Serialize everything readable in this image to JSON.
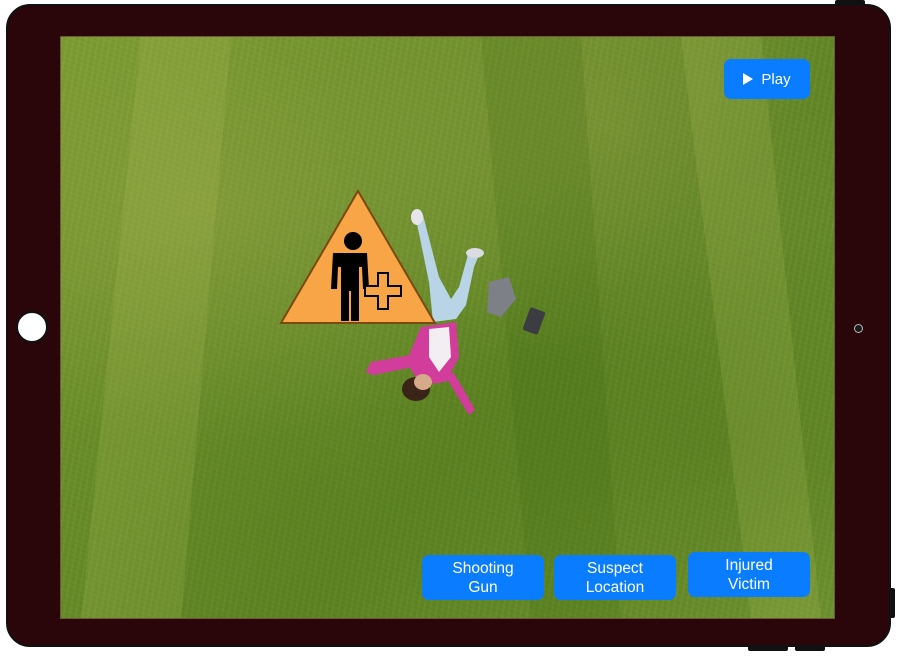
{
  "screen": {
    "play_label": "Play",
    "play_icon": "play-triangle-icon",
    "marker_icon": "injured-person-warning-icon",
    "marker_color": "#f7a547",
    "accent_color": "#0a7cff",
    "device_frame_color": "#2a0509"
  },
  "actions": [
    {
      "label": "Shooting\nGun"
    },
    {
      "label": "Suspect\nLocation"
    },
    {
      "label": "Injured\nVictim"
    }
  ]
}
